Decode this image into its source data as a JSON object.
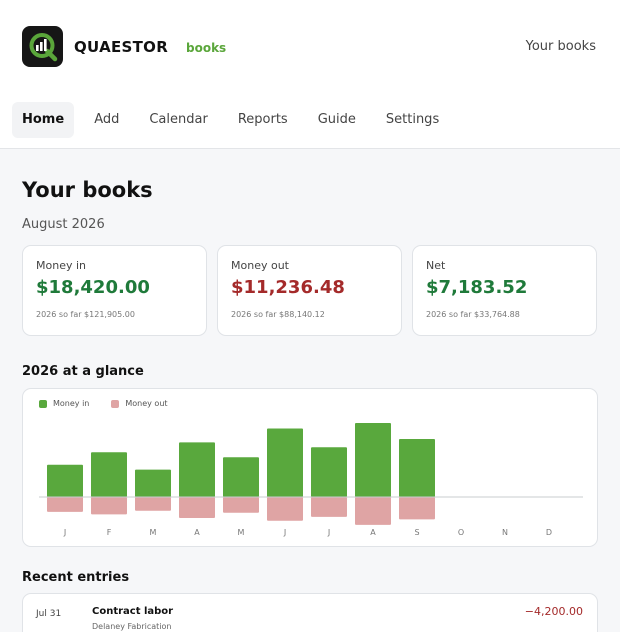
{
  "app": {
    "brand": "QUAESTOR",
    "brand_sub": "books",
    "header_link": "Your books"
  },
  "nav": {
    "items": [
      {
        "label": "Home",
        "active": true
      },
      {
        "label": "Add",
        "active": false
      },
      {
        "label": "Calendar",
        "active": false
      },
      {
        "label": "Reports",
        "active": false
      },
      {
        "label": "Guide",
        "active": false
      },
      {
        "label": "Settings",
        "active": false
      }
    ]
  },
  "page": {
    "title": "Your books",
    "period": "August 2026"
  },
  "stats": [
    {
      "label": "Money in",
      "value": "$18,420.00",
      "sub": "2026 so far $121,905.00",
      "tone": "green"
    },
    {
      "label": "Money out",
      "value": "$11,236.48",
      "sub": "2026 so far $88,140.12",
      "tone": "red"
    },
    {
      "label": "Net",
      "value": "$7,183.52",
      "sub": "2026 so far $33,764.88",
      "tone": "green"
    }
  ],
  "glance": {
    "title": "2026 at a glance"
  },
  "colors": {
    "money_in": "#59a83d",
    "money_out": "#dfa4a4",
    "axis": "#c9cccf"
  },
  "chart_data": {
    "type": "bar",
    "categories": [
      "J",
      "F",
      "M",
      "A",
      "M",
      "J",
      "J",
      "A",
      "S",
      "O",
      "N",
      "D"
    ],
    "series": [
      {
        "name": "Money in",
        "values": [
          11700,
          16200,
          9900,
          19800,
          14400,
          24800,
          18000,
          26800,
          21000,
          null,
          null,
          null
        ]
      },
      {
        "name": "Money out",
        "values": [
          -5400,
          -6300,
          -5000,
          -7600,
          -5700,
          -8600,
          -7200,
          -10100,
          -8100,
          null,
          null,
          null
        ]
      }
    ],
    "ylim": [
      -12000,
      30000
    ],
    "grid": false,
    "legend": "top-left"
  },
  "recent": {
    "title": "Recent entries",
    "entries": [
      {
        "date": "Jul 31",
        "title": "Contract labor",
        "sub": "Delaney Fabrication",
        "amount": "−4,200.00"
      }
    ]
  }
}
